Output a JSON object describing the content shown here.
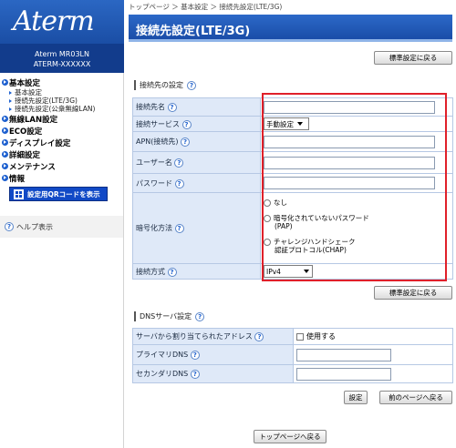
{
  "sidebar": {
    "logo": "Aterm",
    "model": "Aterm MR03LN",
    "device_id": "ATERM-XXXXXX",
    "categories": [
      {
        "label": "基本設定",
        "subs": [
          "基本設定",
          "接続先設定(LTE/3G)",
          "接続先設定(公衆無線LAN)"
        ]
      },
      {
        "label": "無線LAN設定",
        "subs": []
      },
      {
        "label": "ECO設定",
        "subs": []
      },
      {
        "label": "ディスプレイ設定",
        "subs": []
      },
      {
        "label": "詳細設定",
        "subs": []
      },
      {
        "label": "メンテナンス",
        "subs": []
      },
      {
        "label": "情報",
        "subs": []
      }
    ],
    "qr_button": "設定用QRコードを表示",
    "help": "ヘルプ表示"
  },
  "header": {
    "breadcrumb": "トップページ ＞ 基本設定 ＞ 接続先設定(LTE/3G)",
    "title": "接続先設定(LTE/3G)"
  },
  "buttons": {
    "default_top": "標準設定に戻る",
    "default_mid": "標準設定に戻る",
    "set": "設定",
    "back": "前のページへ戻る",
    "top": "トップページへ戻る"
  },
  "connection": {
    "section": "接続先の設定",
    "help_mark": "?",
    "name_label": "接続先名",
    "name_value": "",
    "service_label": "接続サービス",
    "service_value": "手動設定",
    "apn_label": "APN(接続先)",
    "apn_value": "",
    "user_label": "ユーザー名",
    "user_value": "",
    "password_label": "パスワード",
    "password_value": "",
    "auth_label": "暗号化方法",
    "auth_options": [
      {
        "line1": "なし",
        "line2": ""
      },
      {
        "line1": "暗号化されていないパスワード",
        "line2": "(PAP)"
      },
      {
        "line1": "チャレンジハンドシェーク",
        "line2": "認証プロトコル(CHAP)"
      }
    ],
    "method_label": "接続方式",
    "method_value": "IPv4"
  },
  "dns": {
    "section": "DNSサーバ設定",
    "auto_label": "サーバから割り当てられたアドレス",
    "auto_option": "使用する",
    "primary_label": "プライマリDNS",
    "primary_value": "",
    "secondary_label": "セカンダリDNS",
    "secondary_value": ""
  },
  "colors": {
    "accent": "#1c5fcf",
    "title_bar": "#2c69c8",
    "label_bg": "#dfe9f8",
    "highlight": "#e0202a"
  }
}
